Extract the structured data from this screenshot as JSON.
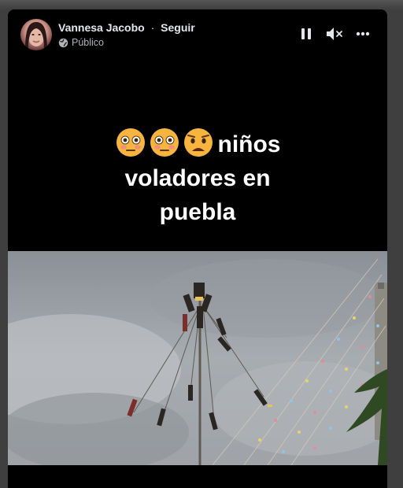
{
  "post": {
    "author": "Vannesa Jacobo",
    "separator": "·",
    "follow_label": "Seguir",
    "privacy": "Público",
    "icons": {
      "avatar": "profile-photo",
      "privacy": "globe-icon",
      "pause": "pause-icon",
      "mute": "volume-muted-icon",
      "more": "more-options-icon"
    }
  },
  "video": {
    "caption_line1": "niños",
    "caption_line2": "voladores en",
    "caption_line3": "puebla",
    "emojis": [
      "flushed-face",
      "flushed-face",
      "anguished-face"
    ]
  },
  "colors": {
    "background": "#000000",
    "text_primary": "#e4e6eb",
    "text_secondary": "#b0b3b8",
    "emoji_yellow": "#f7b53f"
  }
}
